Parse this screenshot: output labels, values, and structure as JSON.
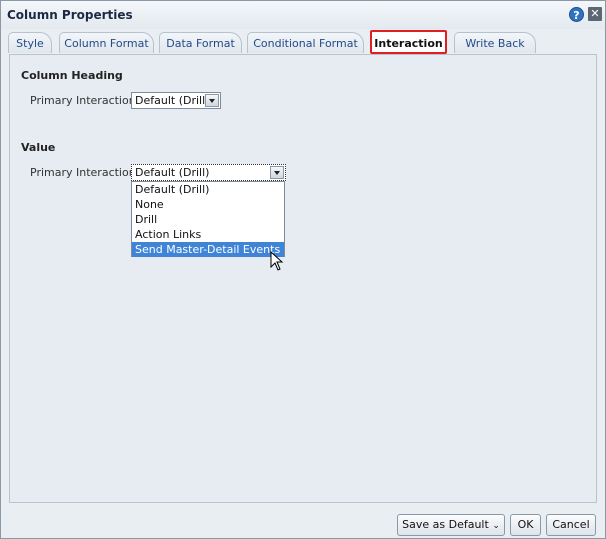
{
  "dialog": {
    "title": "Column Properties"
  },
  "tabs": [
    {
      "label": "Style"
    },
    {
      "label": "Column Format"
    },
    {
      "label": "Data Format"
    },
    {
      "label": "Conditional Format"
    },
    {
      "label": "Interaction"
    },
    {
      "label": "Write Back"
    }
  ],
  "column_heading": {
    "title": "Column Heading",
    "primary_label": "Primary Interaction",
    "primary_value": "Default (Drill)"
  },
  "value_section": {
    "title": "Value",
    "primary_label": "Primary Interaction",
    "primary_value": "Default (Drill)",
    "options": [
      "Default (Drill)",
      "None",
      "Drill",
      "Action Links",
      "Send Master-Detail Events"
    ],
    "highlighted_option": "Send Master-Detail Events"
  },
  "buttons": {
    "save_default": "Save as Default",
    "ok": "OK",
    "cancel": "Cancel"
  },
  "colors": {
    "active_tab_border": "#e02020",
    "highlight": "#3f84d6"
  },
  "icons": {
    "help": "help-icon",
    "close": "close-icon",
    "dropdown_arrow": "chevron-down-icon",
    "cursor": "mouse-pointer-icon"
  }
}
